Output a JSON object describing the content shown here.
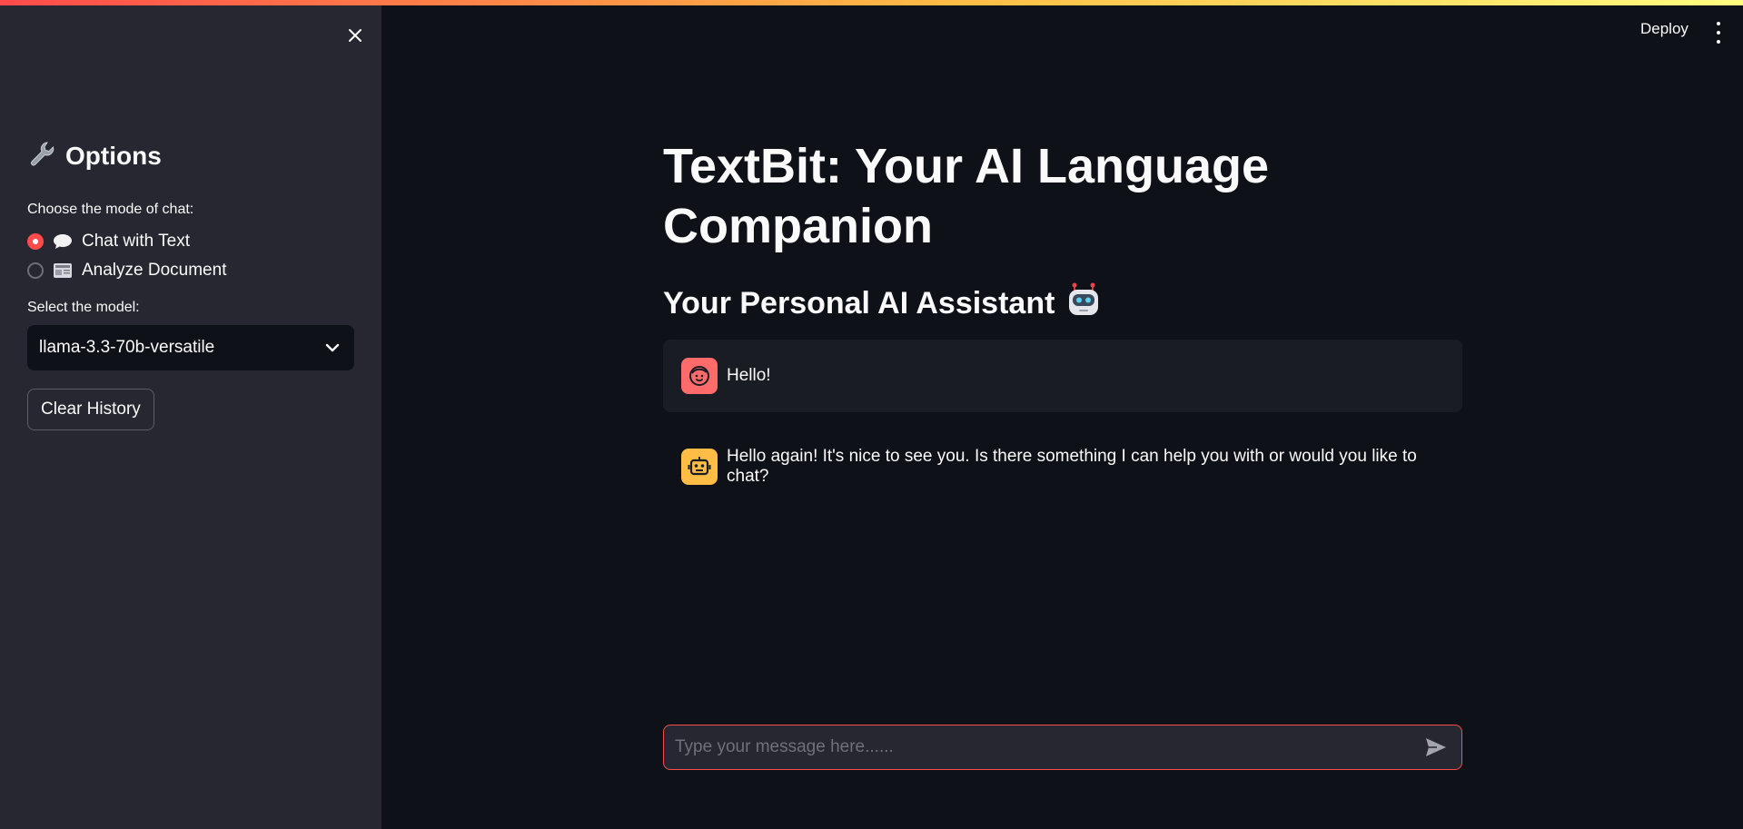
{
  "header": {
    "deploy_label": "Deploy",
    "accent_gradient": [
      "#ff4b4b",
      "#ffbd45",
      "#fffd80"
    ]
  },
  "sidebar": {
    "title": "Options",
    "title_icon": "wrench-icon",
    "mode_label": "Choose the mode of chat:",
    "modes": [
      {
        "label": "Chat with Text",
        "icon": "speech-bubble-icon",
        "selected": true
      },
      {
        "label": "Analyze Document",
        "icon": "newspaper-icon",
        "selected": false
      }
    ],
    "model_label": "Select the model:",
    "model_selected": "llama-3.3-70b-versatile",
    "clear_label": "Clear History"
  },
  "main": {
    "title": "TextBit: Your AI Language Companion",
    "subtitle": "Your Personal AI Assistant",
    "subtitle_icon": "robot-emoji-icon",
    "messages": [
      {
        "role": "user",
        "avatar": "user-face-icon",
        "text": "Hello!"
      },
      {
        "role": "assistant",
        "avatar": "robot-icon",
        "text": "Hello again! It's nice to see you. Is there something I can help you with or would you like to chat?"
      }
    ]
  },
  "chat_input": {
    "placeholder": "Type your message here......",
    "value": ""
  },
  "colors": {
    "background": "#0e1117",
    "sidebar": "#262730",
    "primary": "#ff4b4b",
    "user_avatar": "#ff6b6b",
    "bot_avatar": "#ffbd45"
  }
}
